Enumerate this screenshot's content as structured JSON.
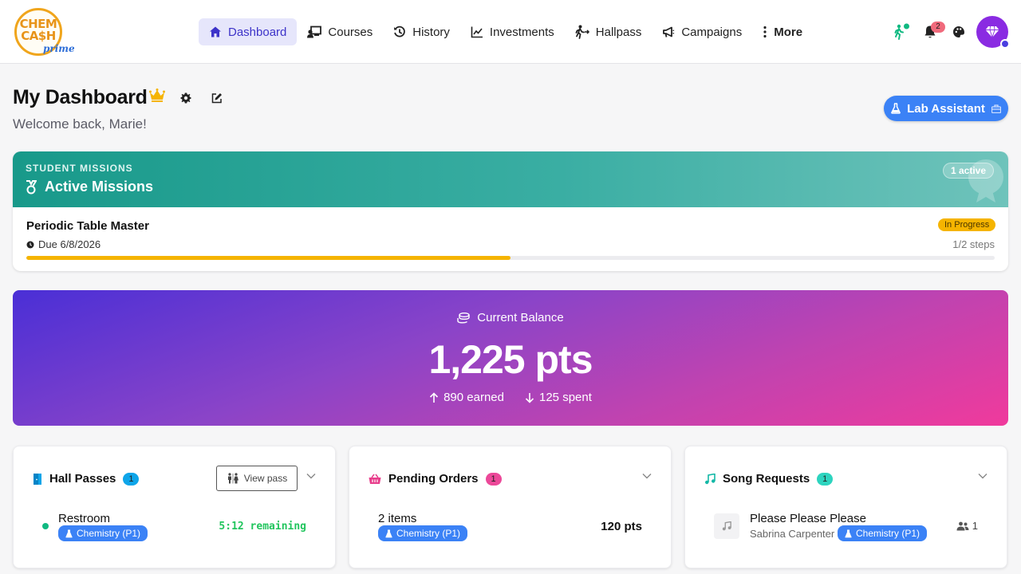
{
  "logo": {
    "line1": "CHEM",
    "line2": "CA$H",
    "line3": "prime"
  },
  "nav": {
    "items": [
      {
        "label": "Dashboard",
        "icon": "home-icon"
      },
      {
        "label": "Courses",
        "icon": "chalkboard-user-icon"
      },
      {
        "label": "History",
        "icon": "history-icon"
      },
      {
        "label": "Investments",
        "icon": "chart-line-icon"
      },
      {
        "label": "Hallpass",
        "icon": "person-walking-exit-icon"
      },
      {
        "label": "Campaigns",
        "icon": "megaphone-icon"
      },
      {
        "label": "More",
        "icon": "ellipsis-vertical-icon"
      }
    ]
  },
  "topbar": {
    "notification_count": "2",
    "colors": {
      "accent": "#3d33c9",
      "avatar": "#8a2be2"
    }
  },
  "header": {
    "title": "My Dashboard",
    "welcome": "Welcome back, Marie!",
    "lab_assistant_label": "Lab Assistant"
  },
  "missions": {
    "kicker": "STUDENT MISSIONS",
    "title": "Active Missions",
    "count_label": "1 active",
    "mission": {
      "name": "Periodic Table Master",
      "due": "Due 6/8/2026",
      "status": "In Progress",
      "steps": "1/2 steps",
      "progress": 0.5
    }
  },
  "balance": {
    "label": "Current Balance",
    "value": "1,225 pts",
    "earned": "890 earned",
    "spent": "125 spent",
    "colors": {
      "start": "#4a2fd6",
      "end": "#f03a9c"
    }
  },
  "hall_passes": {
    "title": "Hall Passes",
    "count": "1",
    "view_label": "View pass",
    "pass": {
      "name": "Restroom",
      "course": "Chemistry (P1)",
      "remaining": "5:12 remaining"
    }
  },
  "pending_orders": {
    "title": "Pending Orders",
    "count": "1",
    "order": {
      "items": "2 items",
      "course": "Chemistry (P1)",
      "total": "120 pts"
    }
  },
  "song_requests": {
    "title": "Song Requests",
    "count": "1",
    "song": {
      "title": "Please Please Please",
      "artist": "Sabrina Carpenter",
      "course": "Chemistry (P1)",
      "votes": "1"
    }
  }
}
